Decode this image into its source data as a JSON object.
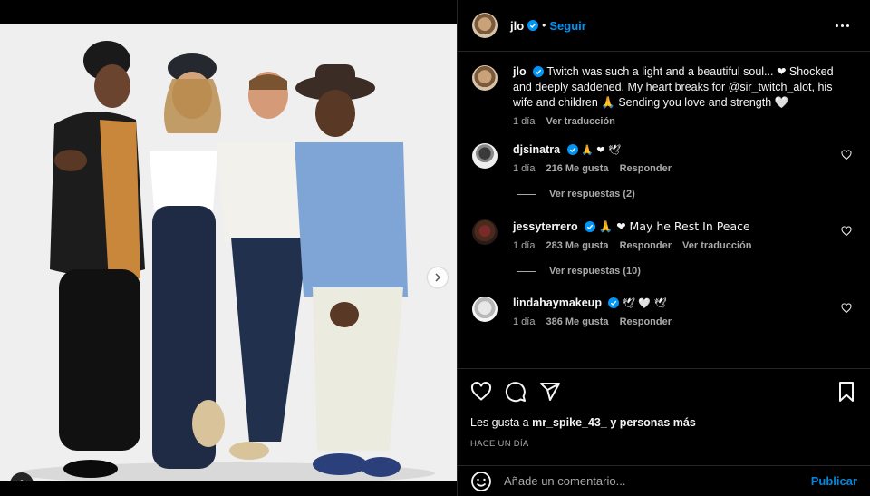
{
  "post": {
    "author": "jlo",
    "follow_label": "Seguir",
    "separator": "•"
  },
  "caption": {
    "username": "jlo",
    "text": "Twitch was such a light and a beautiful soul... ❤ Shocked and deeply saddened. My heart breaks for @sir_twitch_alot, his wife and children 🙏 Sending you love and strength 🤍",
    "time": "1 día",
    "translate": "Ver traducción"
  },
  "comments": [
    {
      "username": "djsinatra",
      "text": "🙏 ❤ 🕊",
      "time": "1 día",
      "likes": "216 Me gusta",
      "reply": "Responder",
      "translate": "",
      "replies": "Ver respuestas (2)"
    },
    {
      "username": "jessyterrero",
      "text": "🙏 ❤ May he Rest In Peace",
      "time": "1 día",
      "likes": "283 Me gusta",
      "reply": "Responder",
      "translate": "Ver traducción",
      "replies": "Ver respuestas (10)"
    },
    {
      "username": "lindahaymakeup",
      "text": "🕊 🤍 🕊",
      "time": "1 día",
      "likes": "386 Me gusta",
      "reply": "Responder",
      "translate": "",
      "replies": ""
    }
  ],
  "likes_line": {
    "prefix": "Les gusta a",
    "user": "mr_spike_43_",
    "suffix": "y personas más"
  },
  "posted_time": "HACE UN DÍA",
  "add_comment": {
    "placeholder": "Añade un comentario...",
    "publish": "Publicar"
  },
  "colors": {
    "accent": "#0095f6",
    "background": "#000000",
    "muted": "#a8a8a8",
    "heart": "#ed4956"
  },
  "icons": [
    "more-options-icon",
    "verified-badge-icon",
    "heart-icon",
    "comment-icon",
    "share-icon",
    "bookmark-icon",
    "emoji-icon",
    "next-arrow-icon",
    "user-tag-icon"
  ]
}
